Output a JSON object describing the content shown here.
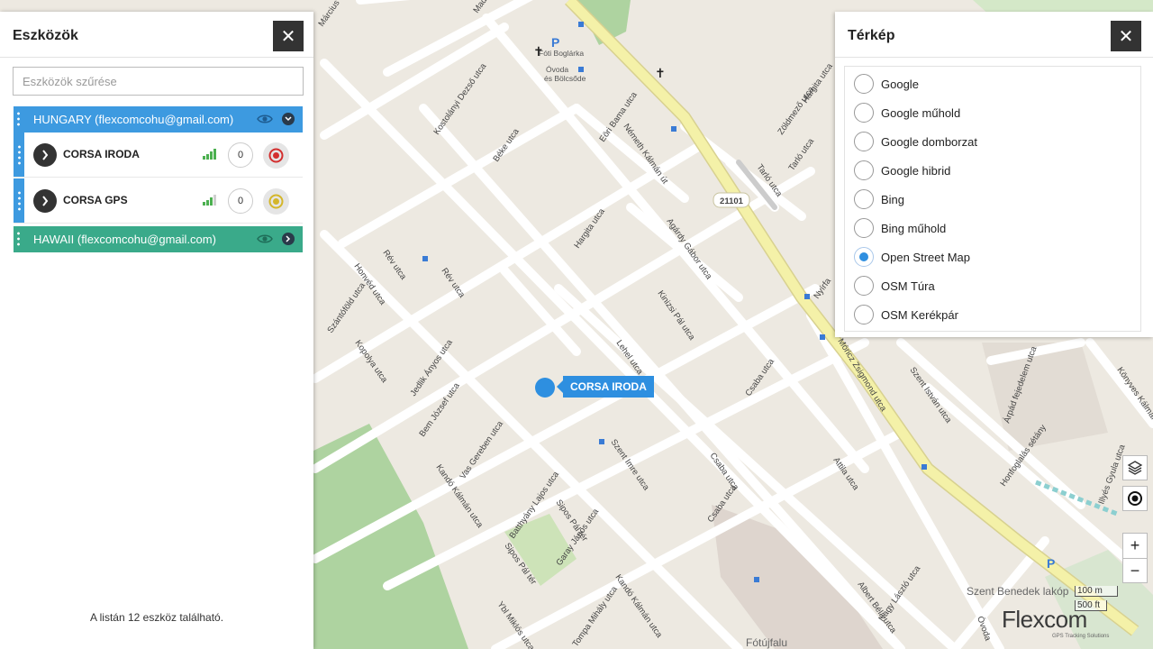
{
  "left_panel": {
    "title": "Eszközök",
    "close_icon": "close-icon",
    "filter_placeholder": "Eszközök szűrése",
    "groups": [
      {
        "name": "HUNGARY (flexcomcohu@gmail.com)",
        "color": "#3d9ae0",
        "expanded": true,
        "devices": [
          {
            "name": "CORSA IRODA",
            "count": "0",
            "status_icon": "target-red-icon",
            "signal_icon": "signal-bars-icon"
          },
          {
            "name": "CORSA GPS",
            "count": "0",
            "status_icon": "target-yellow-icon",
            "signal_icon": "signal-bars-icon"
          }
        ]
      },
      {
        "name": "HAWAII (flexcomcohu@gmail.com)",
        "color": "#3aaa8a",
        "expanded": false,
        "devices": []
      }
    ],
    "footer": "A listán 12 eszköz található."
  },
  "right_panel": {
    "title": "Térkép",
    "close_icon": "close-icon",
    "layers": [
      {
        "label": "Google",
        "selected": false
      },
      {
        "label": "Google műhold",
        "selected": false
      },
      {
        "label": "Google domborzat",
        "selected": false
      },
      {
        "label": "Google hibrid",
        "selected": false
      },
      {
        "label": "Bing",
        "selected": false
      },
      {
        "label": "Bing műhold",
        "selected": false
      },
      {
        "label": "Open Street Map",
        "selected": true
      },
      {
        "label": "OSM Túra",
        "selected": false
      },
      {
        "label": "OSM Kerékpár",
        "selected": false
      }
    ]
  },
  "map": {
    "marker_label": "CORSA IRODA",
    "road_number": "21101",
    "scale_metric": "100 m",
    "scale_imperial": "500 ft",
    "zoom_in": "+",
    "zoom_out": "−",
    "layers_icon": "layers-icon",
    "locate_icon": "locate-icon",
    "logo_text": "Flexcom",
    "logo_subtext": "GPS Tracking Solutions",
    "district_labels": [
      "Szent Benedek lakóp",
      "Fótújfalu"
    ],
    "poi": [
      "Fóti Boglárka",
      "Óvoda",
      "és Bölcsőde"
    ],
    "streets": [
      "Március",
      "Madách",
      "Németh Kálmán út",
      "Kostolányi Dezső utca",
      "Béke utca",
      "Eöri Bama utca",
      "Hargita utca",
      "Zöldmező utca",
      "Tarló utca",
      "Tarló utca",
      "Hargita utca",
      "Agárdy Gábor utca",
      "Kinizsi Pál utca",
      "Nyírfa",
      "Móricz Zsigmond utca",
      "Rév utca",
      "Rév utca",
      "Honvéd utca",
      "Szántóföld utca",
      "Kopolya utca",
      "Jedlik Ányos utca",
      "Bem József utca",
      "Lehel utca",
      "Csaba utca",
      "Vas Gereben utca",
      "Szent Imre utca",
      "Kandó Kálmán utca",
      "Batthyány Lajos utca",
      "Sipos Pál tér",
      "Sipos Pál tér",
      "Garay János utca",
      "Csaba utca",
      "Csaba utca",
      "Kandó Kálmán utca",
      "Tompa Mihály utca",
      "Ybl Miklós utca",
      "Albert Béla utca",
      "Attila utca",
      "Nagy László utca",
      "Szent István utca",
      "Árpád fejedelem utca",
      "Honfoglalás sétány",
      "Illyés Gyula utca",
      "Könyves Kálmán utca",
      "Óvoda",
      "Kandó Kálmán utca"
    ]
  }
}
